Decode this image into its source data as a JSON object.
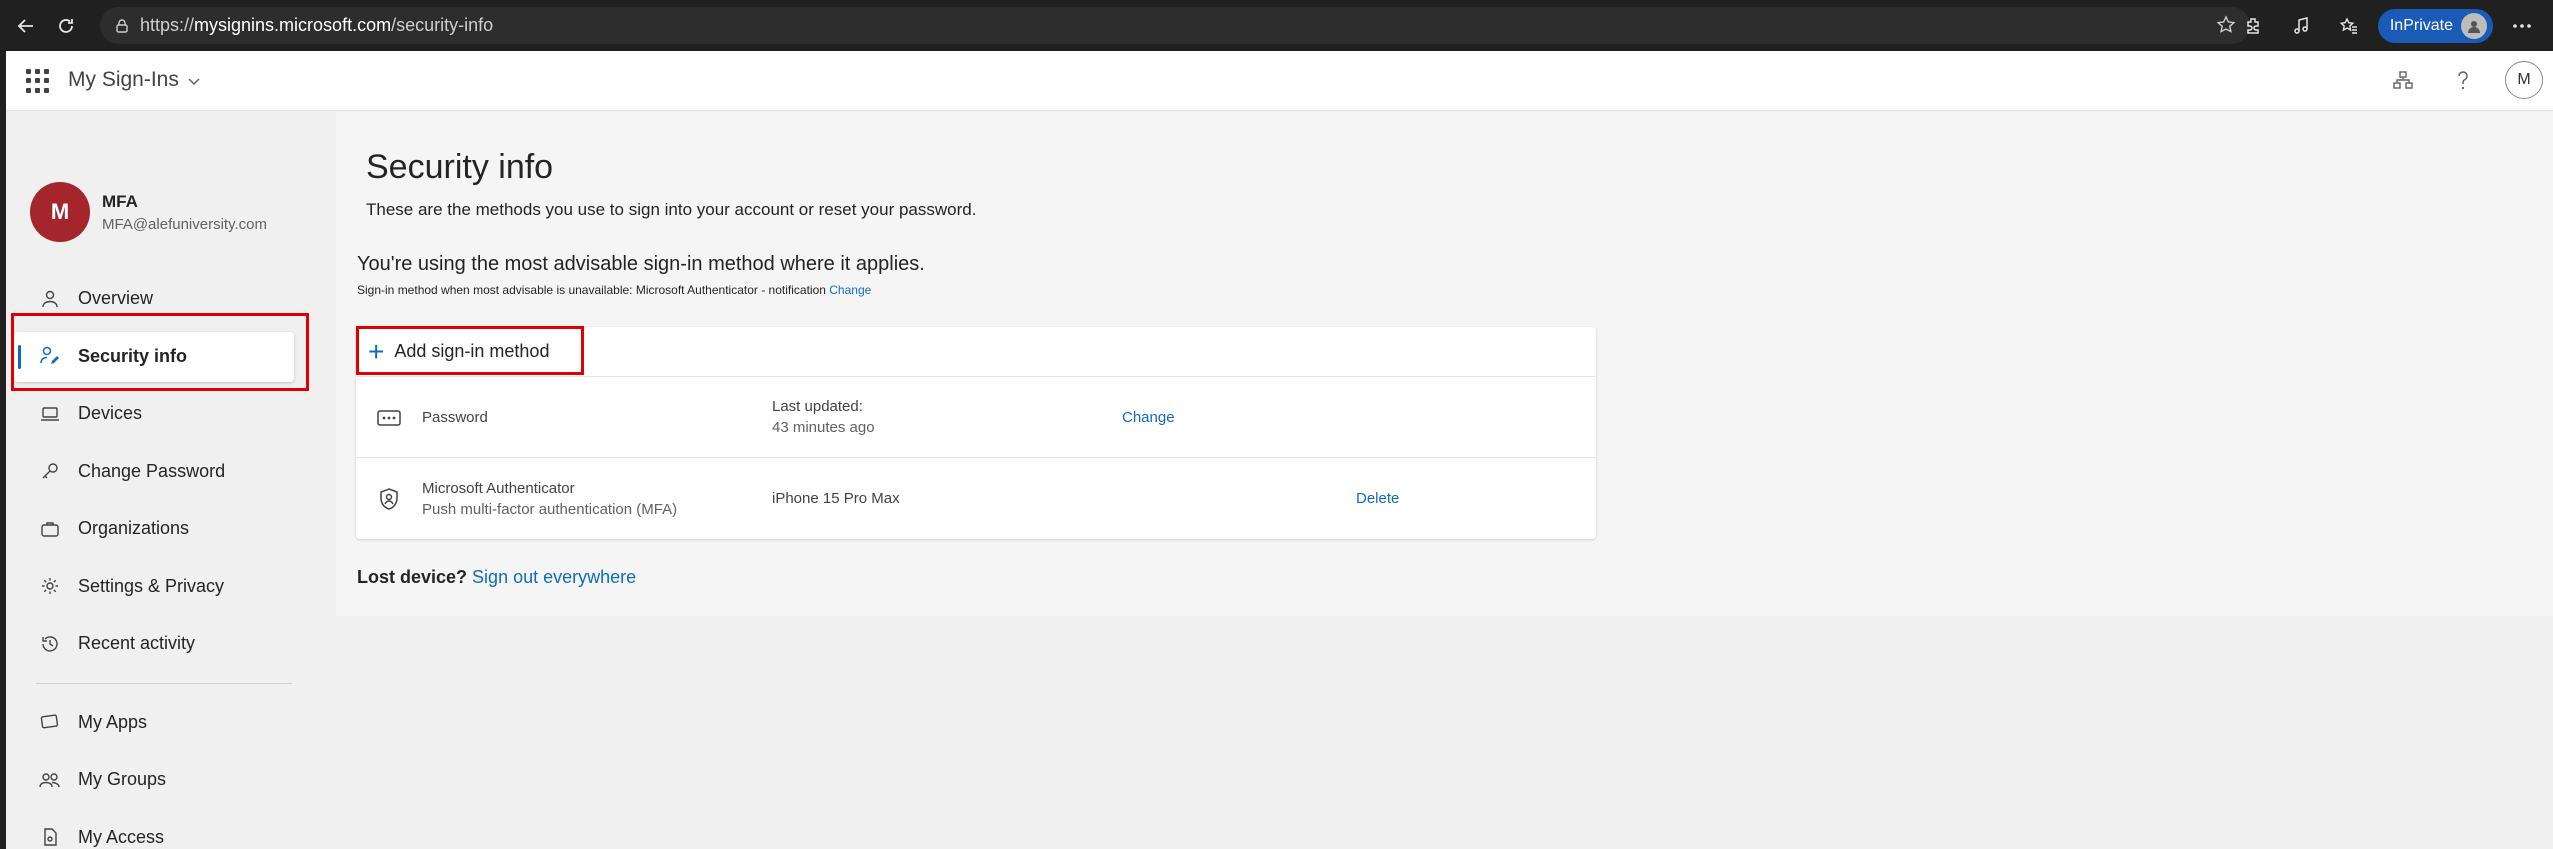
{
  "browser": {
    "url_prefix": "https://",
    "url_host": "mysignins.microsoft.com",
    "url_path": "/security-info",
    "inprivate_label": "InPrivate"
  },
  "header": {
    "app_title": "My Sign-Ins",
    "avatar_initial": "M"
  },
  "user": {
    "initial": "M",
    "name": "MFA",
    "email": "MFA@alefuniversity.com"
  },
  "sidebar": {
    "items": [
      {
        "label": "Overview",
        "icon": "person-icon"
      },
      {
        "label": "Security info",
        "icon": "security-info-icon",
        "active": true
      },
      {
        "label": "Devices",
        "icon": "laptop-icon"
      },
      {
        "label": "Change Password",
        "icon": "key-icon"
      },
      {
        "label": "Organizations",
        "icon": "briefcase-icon"
      },
      {
        "label": "Settings & Privacy",
        "icon": "gear-icon"
      },
      {
        "label": "Recent activity",
        "icon": "history-icon"
      }
    ],
    "secondary_items": [
      {
        "label": "My Apps",
        "icon": "apps-icon"
      },
      {
        "label": "My Groups",
        "icon": "groups-icon"
      },
      {
        "label": "My Access",
        "icon": "access-icon"
      }
    ]
  },
  "main": {
    "title": "Security info",
    "description": "These are the methods you use to sign into your account or reset your password.",
    "advise_title": "You're using the most advisable sign-in method where it applies.",
    "advise_sub": "Sign-in method when most advisable is unavailable: Microsoft Authenticator - notification",
    "advise_change": "Change",
    "add_method_label": "Add sign-in method",
    "methods": [
      {
        "name": "Password",
        "detail_label": "Last updated:",
        "detail_value": "43 minutes ago",
        "action": "Change"
      },
      {
        "name": "Microsoft Authenticator",
        "sub": "Push multi-factor authentication (MFA)",
        "detail_value": "iPhone 15 Pro Max",
        "action": "Delete"
      }
    ],
    "lost_device_label": "Lost device?",
    "sign_out_link": "Sign out everywhere"
  },
  "colors": {
    "accent": "#0f6cbd",
    "highlight_box": "#e00000",
    "user_avatar": "#a4262c"
  }
}
